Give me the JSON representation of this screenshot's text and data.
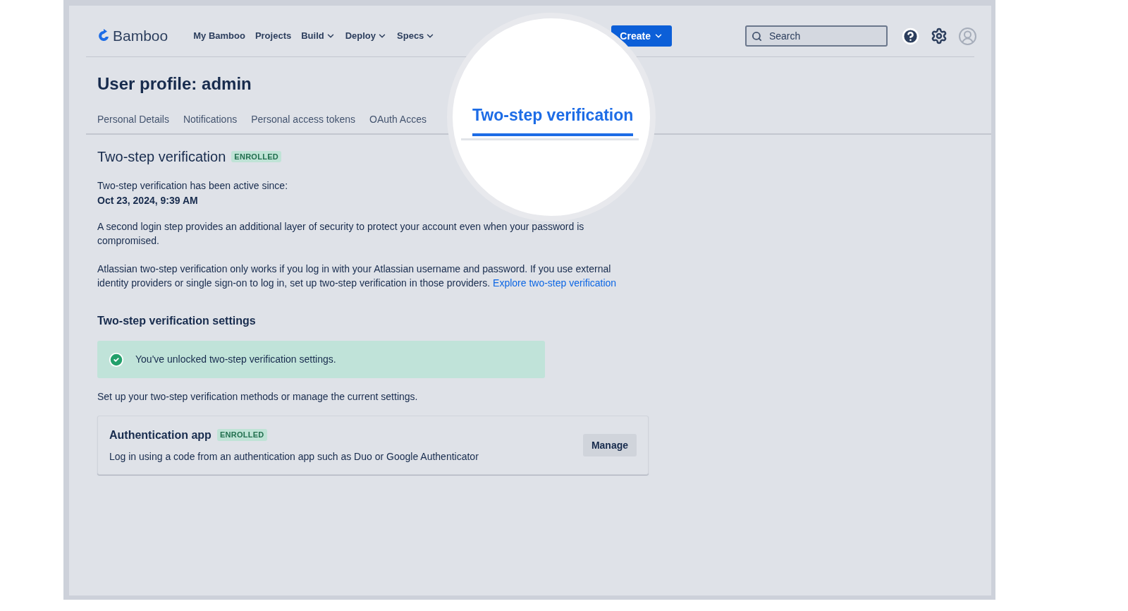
{
  "header": {
    "logo": "Bamboo",
    "nav": [
      {
        "label": "My Bamboo",
        "dropdown": false
      },
      {
        "label": "Projects",
        "dropdown": false
      },
      {
        "label": "Build",
        "dropdown": true
      },
      {
        "label": "Deploy",
        "dropdown": true
      },
      {
        "label": "Specs",
        "dropdown": true
      }
    ],
    "create_button": "Create",
    "search": {
      "placeholder": "Search"
    }
  },
  "page_title": "User profile: admin",
  "tabs": [
    {
      "label": "Personal Details",
      "selected": false
    },
    {
      "label": "Notifications",
      "selected": false
    },
    {
      "label": "Personal access tokens",
      "selected": false
    },
    {
      "label": "OAuth Acces",
      "selected": false
    },
    {
      "label": "Two-step verification",
      "selected": true
    }
  ],
  "section": {
    "title": "Two-step verification",
    "badge": "ENROLLED",
    "active_since_label": "Two-step verification has been active since:",
    "active_since": "Oct 23, 2024, 9:39 AM",
    "paragraph_1": "A second login step provides an additional layer of security to protect your account even when your password is compromised.",
    "paragraph_2": "Atlassian two-step verification only works if you log in with your Atlassian username and password. If you use external identity providers or single sign-on to log in, set up two-step verification in those providers.",
    "link": "Explore two-step verification"
  },
  "settings": {
    "title": "Two-step verification settings",
    "success_message": "You've unlocked two-step verification settings.",
    "description": "Set up your two-step verification methods or manage the current settings.",
    "methods": [
      {
        "name": "Authentication app",
        "badge": "ENROLLED",
        "description": "Log in using a code from an authentication app such as Duo or Google Authenticator",
        "button": "Manage"
      }
    ]
  }
}
